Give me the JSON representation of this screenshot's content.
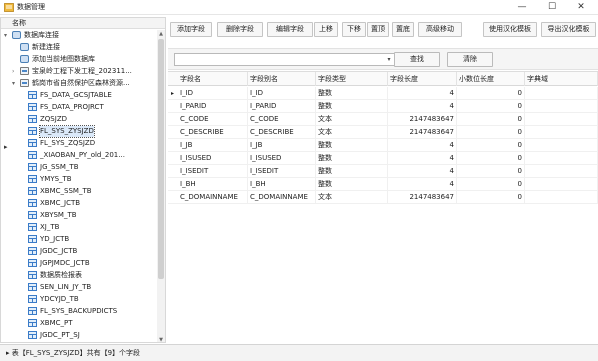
{
  "window": {
    "title": "数据管理",
    "min": "—",
    "max": "☐",
    "close": "✕"
  },
  "tree": {
    "header": "名称",
    "items": [
      {
        "label": "数据库连接",
        "level": 0,
        "expand": "▾",
        "icon": "folder-db"
      },
      {
        "label": "新建连接",
        "level": 1,
        "expand": "",
        "icon": "db"
      },
      {
        "label": "添加当前地图数据库",
        "level": 1,
        "expand": "",
        "icon": "db"
      },
      {
        "label": "宝泉岭工程下发工程_202311...",
        "level": 1,
        "expand": "›",
        "icon": "connection"
      },
      {
        "label": "鹤岗市省自然保护区森林资源...",
        "level": 1,
        "expand": "▾",
        "icon": "connection"
      },
      {
        "label": "FS_DATA_GCSJTABLE",
        "level": 2,
        "expand": "",
        "icon": "table"
      },
      {
        "label": "FS_DATA_PROJRCT",
        "level": 2,
        "expand": "",
        "icon": "table"
      },
      {
        "label": "ZQSJZD",
        "level": 2,
        "expand": "",
        "icon": "table"
      },
      {
        "label": "FL_SYS_ZYSJZD",
        "level": 2,
        "expand": "",
        "icon": "table",
        "selected": true
      },
      {
        "label": "FL_SYS_ZQSJZD",
        "level": 2,
        "expand": "",
        "icon": "table"
      },
      {
        "label": "_XIAOBAN_PY_old_201...",
        "level": 2,
        "expand": "",
        "icon": "table"
      },
      {
        "label": "JG_SSM_TB",
        "level": 2,
        "expand": "",
        "icon": "table"
      },
      {
        "label": "YMYS_TB",
        "level": 2,
        "expand": "",
        "icon": "table"
      },
      {
        "label": "XBMC_SSM_TB",
        "level": 2,
        "expand": "",
        "icon": "table"
      },
      {
        "label": "XBMC_JCTB",
        "level": 2,
        "expand": "",
        "icon": "table"
      },
      {
        "label": "XBYSM_TB",
        "level": 2,
        "expand": "",
        "icon": "table"
      },
      {
        "label": "XJ_TB",
        "level": 2,
        "expand": "",
        "icon": "table"
      },
      {
        "label": "YD_JCTB",
        "level": 2,
        "expand": "",
        "icon": "table"
      },
      {
        "label": "JGDC_JCTB",
        "level": 2,
        "expand": "",
        "icon": "table"
      },
      {
        "label": "JGPJMDC_JCTB",
        "level": 2,
        "expand": "",
        "icon": "table"
      },
      {
        "label": "数据质检报表",
        "level": 2,
        "expand": "",
        "icon": "table"
      },
      {
        "label": "SEN_LIN_JY_TB",
        "level": 2,
        "expand": "",
        "icon": "table"
      },
      {
        "label": "YDCYJD_TB",
        "level": 2,
        "expand": "",
        "icon": "table"
      },
      {
        "label": "FL_SYS_BACKUPDICTS",
        "level": 2,
        "expand": "",
        "icon": "table"
      },
      {
        "label": "XBMC_PT",
        "level": 2,
        "expand": "",
        "icon": "feature"
      },
      {
        "label": "JGDC_PT_SJ",
        "level": 2,
        "expand": "",
        "icon": "feature"
      }
    ]
  },
  "toolbar": {
    "buttons": [
      "添加字段",
      "删除字段",
      "编辑字段",
      "上移",
      "下移",
      "置顶",
      "置底",
      "高级移动",
      "使用汉化模板",
      "导出汉化模板"
    ]
  },
  "filter": {
    "combo_value": "",
    "find_label": "查找",
    "clear_label": "清除",
    "combo_arrow": "▾"
  },
  "grid": {
    "columns": [
      "字段名",
      "字段别名",
      "字段类型",
      "字段长度",
      "小数位长度",
      "字典域"
    ],
    "rows": [
      [
        "I_ID",
        "I_ID",
        "整数",
        "4",
        "0",
        ""
      ],
      [
        "I_PARID",
        "I_PARID",
        "整数",
        "4",
        "0",
        ""
      ],
      [
        "C_CODE",
        "C_CODE",
        "文本",
        "2147483647",
        "0",
        ""
      ],
      [
        "C_DESCRIBE",
        "C_DESCRIBE",
        "文本",
        "2147483647",
        "0",
        ""
      ],
      [
        "I_JB",
        "I_JB",
        "整数",
        "4",
        "0",
        ""
      ],
      [
        "I_ISUSED",
        "I_ISUSED",
        "整数",
        "4",
        "0",
        ""
      ],
      [
        "I_ISEDIT",
        "I_ISEDIT",
        "整数",
        "4",
        "0",
        ""
      ],
      [
        "I_BH",
        "I_BH",
        "整数",
        "4",
        "0",
        ""
      ],
      [
        "C_DOMAINNAME",
        "C_DOMAINNAME",
        "文本",
        "2147483647",
        "0",
        ""
      ]
    ],
    "current_row_marker": "▸"
  },
  "status": {
    "text": "表【FL_SYS_ZYSJZD】共有【9】个字段",
    "row_marker": "▸"
  },
  "colors": {
    "accent": "#3a7bc8",
    "selection": "#dbe9f9"
  }
}
